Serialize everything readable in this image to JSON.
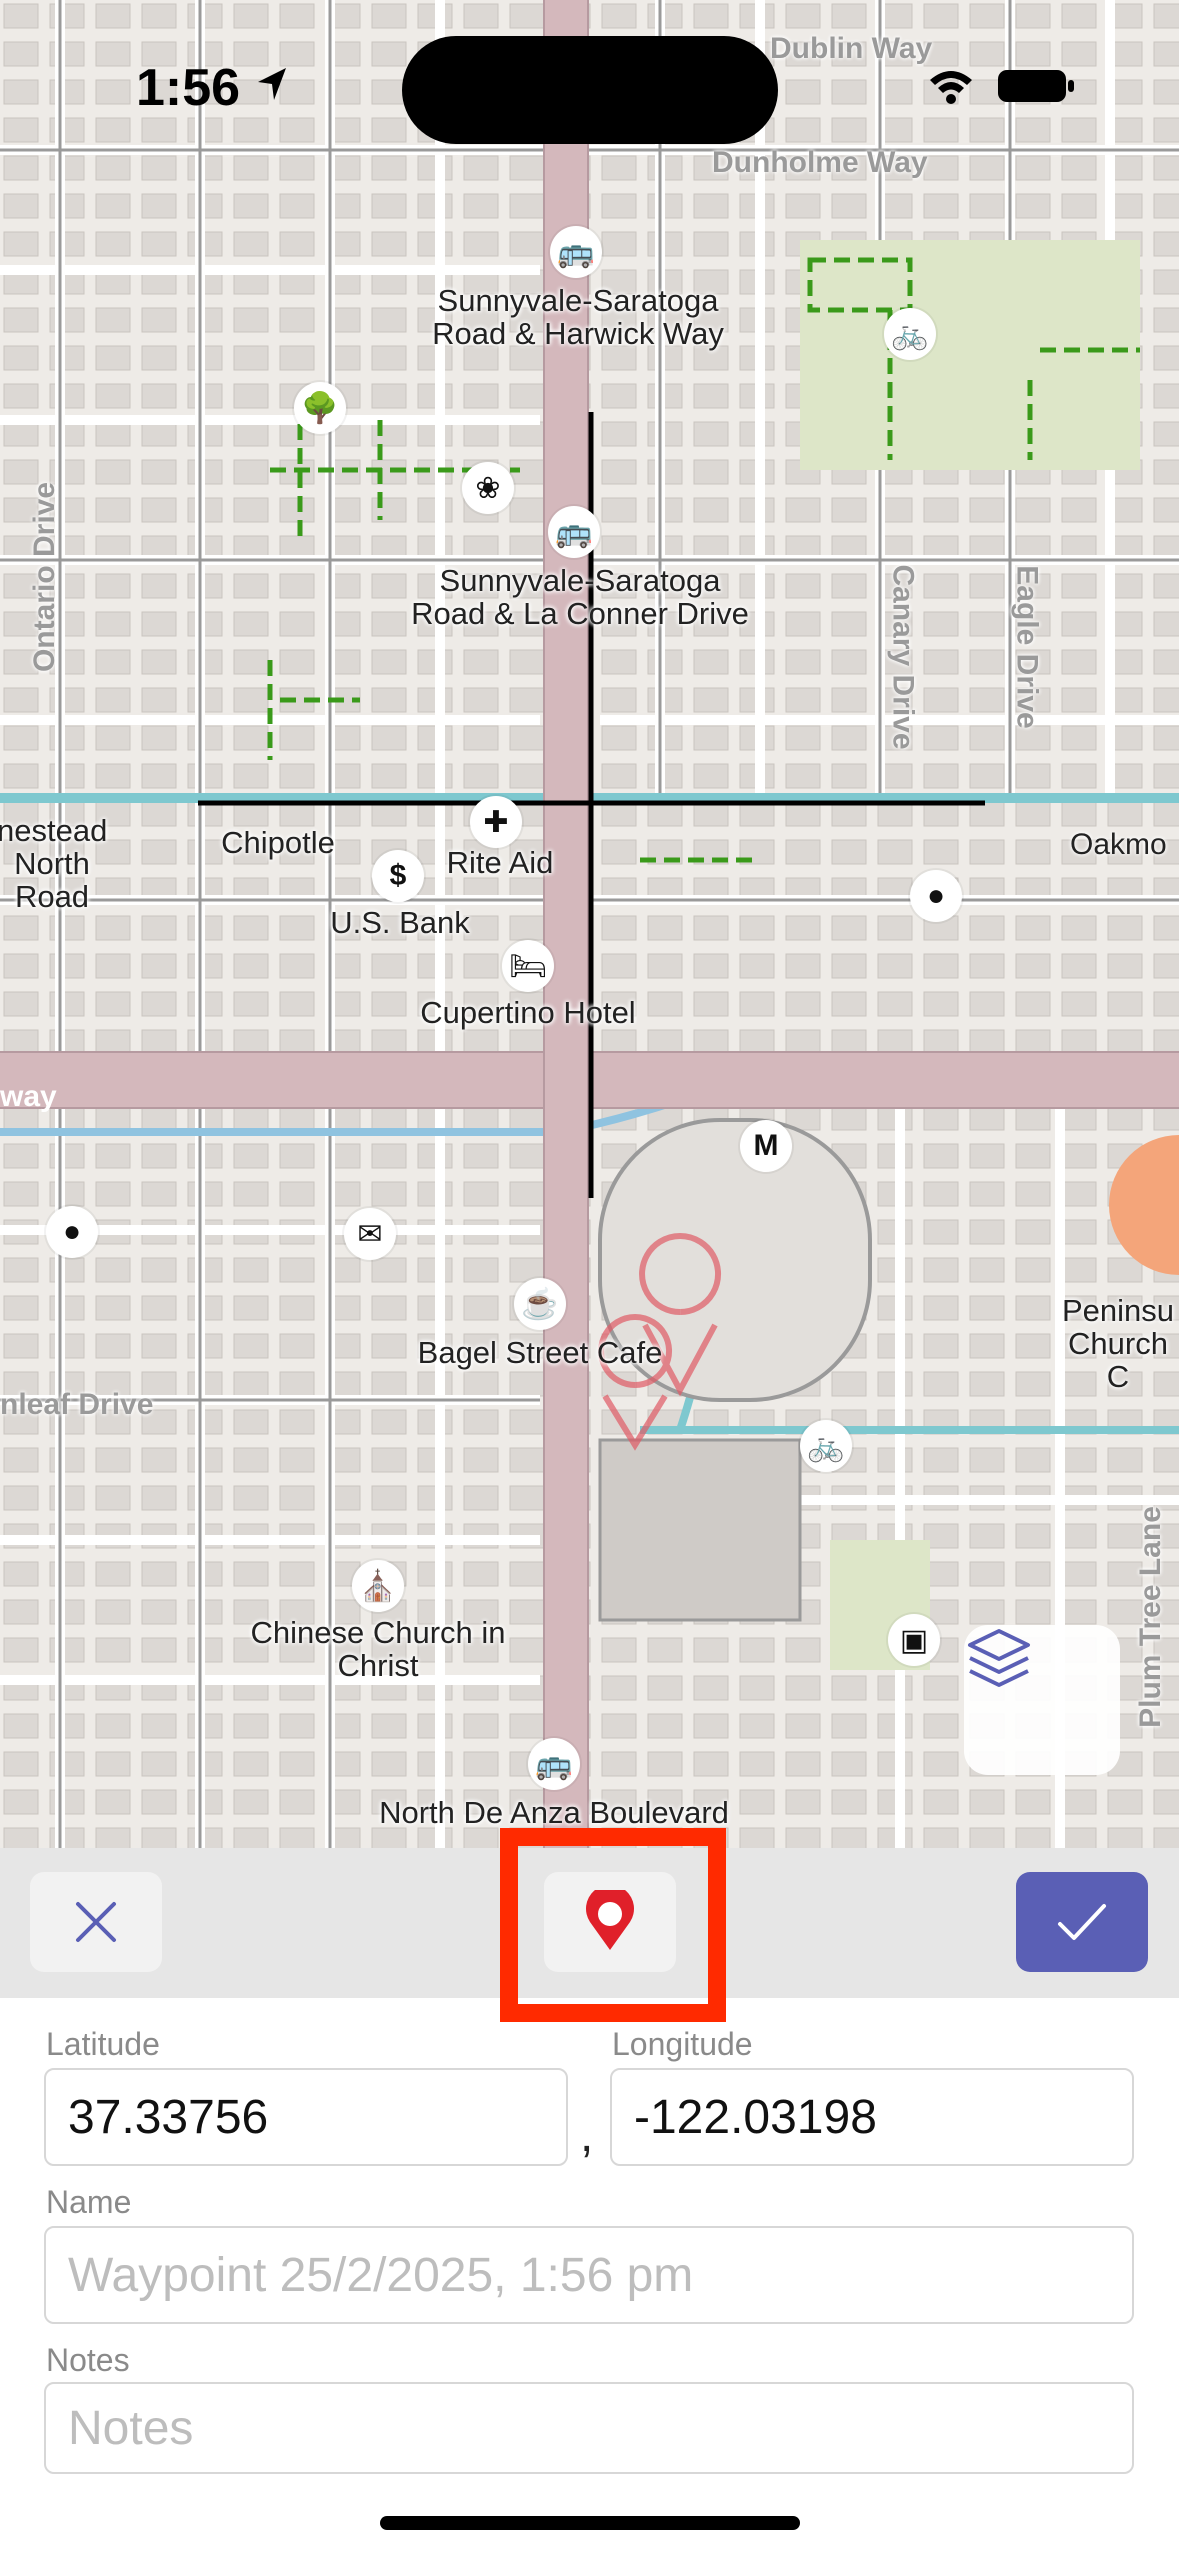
{
  "status_bar": {
    "time": "1:56"
  },
  "map": {
    "street_labels": [
      "Dublin Way",
      "Dunholme Way",
      "Ontario Drive",
      "Canary Drive",
      "Eagle Drive",
      "Plum Tree Lane",
      "way",
      "nleaf Drive",
      "Oakmo",
      "nestead North Road"
    ],
    "poi_labels": [
      "Sunnyvale-Saratoga Road & Harwick Way",
      "Sunnyvale-Saratoga Road & La Conner Drive",
      "Chipotle",
      "Rite Aid",
      "U.S. Bank",
      "Cupertino Hotel",
      "Bagel Street Cafe",
      "Chinese Church in Christ",
      "North De Anza Boulevard",
      "Peninsu Church C"
    ]
  },
  "toolbar": {
    "cancel_icon": "close-icon",
    "pin_icon": "map-pin-icon",
    "confirm_icon": "checkmark-icon"
  },
  "form": {
    "latitude_label": "Latitude",
    "latitude_value": "37.33756",
    "separator": ",",
    "longitude_label": "Longitude",
    "longitude_value": "-122.03198",
    "name_label": "Name",
    "name_placeholder": "Waypoint 25/2/2025, 1:56 pm",
    "notes_label": "Notes",
    "notes_placeholder": "Notes"
  },
  "colors": {
    "accent": "#5a5fb5",
    "highlight": "#ff2a00",
    "pin": "#e0202a"
  }
}
